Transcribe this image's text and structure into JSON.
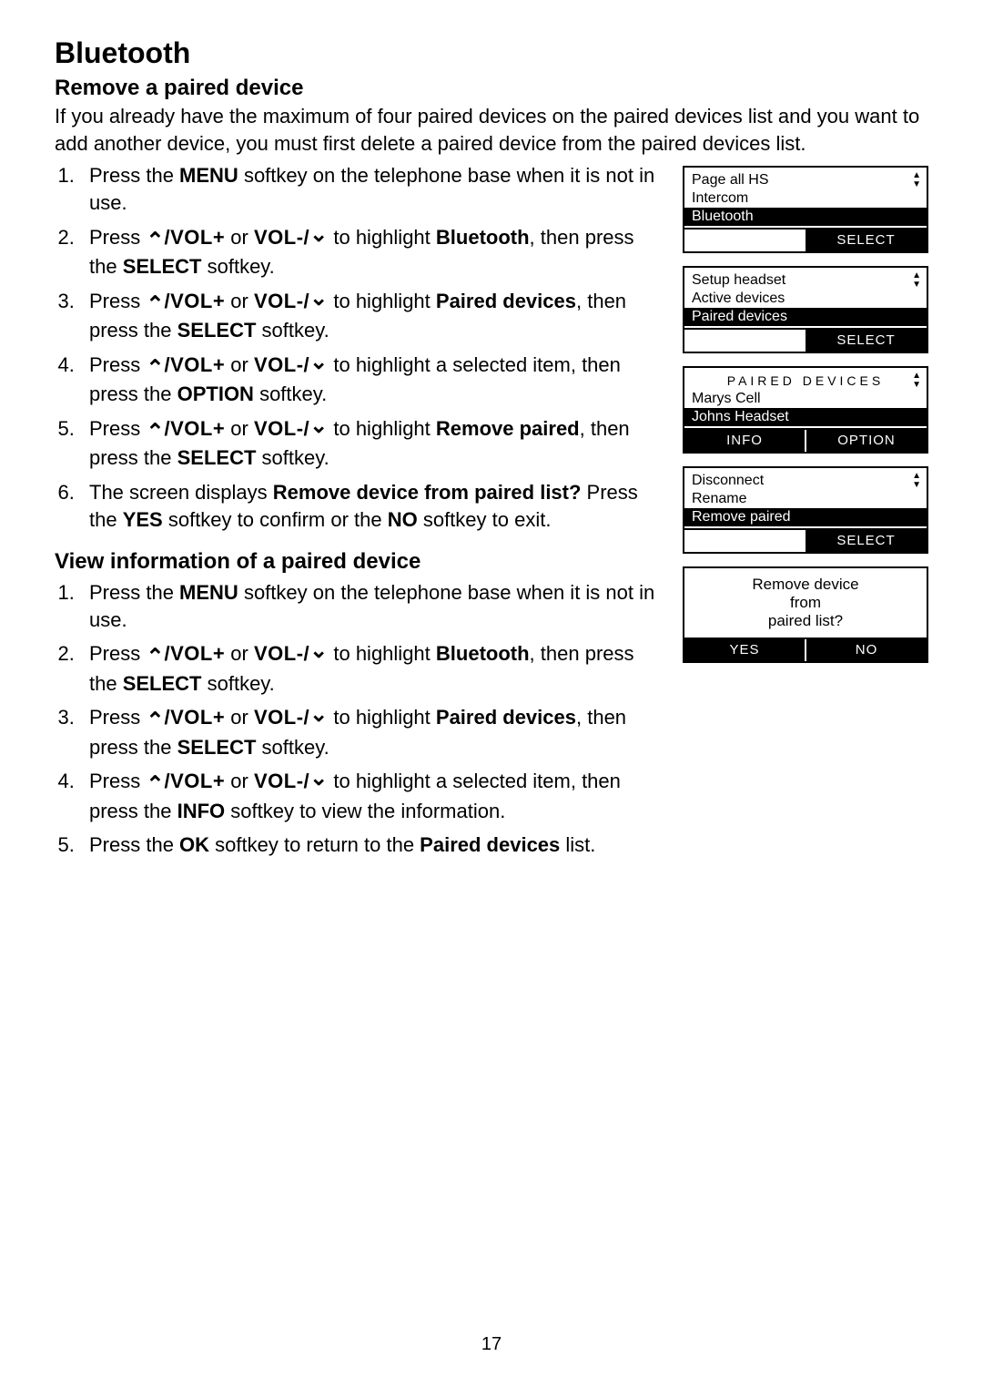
{
  "page_title": "Bluetooth",
  "page_number": "17",
  "icons": {
    "up": "⌃",
    "down": "⌄"
  },
  "vol": {
    "plus": "VOL+",
    "minus": "VOL-/"
  },
  "section_remove": {
    "heading": "Remove a paired device",
    "intro": "If you already have the maximum of four paired devices on the paired devices list and you want to add another device, you must first delete a paired device from the paired devices list.",
    "steps": {
      "s1a": "Press the ",
      "s1b": "MENU",
      "s1c": " softkey on the telephone base when it is not in use.",
      "s2a": "Press ",
      "s2b": " or ",
      "s2c": " to highlight ",
      "s2d": "Bluetooth",
      "s2e": ", then press the ",
      "s2f": "SELECT",
      "s2g": " softkey.",
      "s3a": "Press ",
      "s3b": " or ",
      "s3c": " to highlight ",
      "s3d": "Paired devices",
      "s3e": ", then press the ",
      "s3f": "SELECT",
      "s3g": " softkey.",
      "s4a": "Press ",
      "s4b": " or ",
      "s4c": " to highlight a selected item, then press the ",
      "s4d": "OPTION",
      "s4e": " softkey.",
      "s5a": "Press ",
      "s5b": " or ",
      "s5c": " to highlight ",
      "s5d": "Remove paired",
      "s5e": ", then press the ",
      "s5f": "SELECT",
      "s5g": " softkey.",
      "s6a": "The screen displays ",
      "s6b": "Remove device from paired list?",
      "s6c": " Press the ",
      "s6d": "YES",
      "s6e": " softkey to confirm or the ",
      "s6f": "NO",
      "s6g": " softkey to exit."
    }
  },
  "section_view": {
    "heading": "View information of a paired device",
    "steps": {
      "s1a": "Press the ",
      "s1b": "MENU",
      "s1c": " softkey on the telephone base when it is not in use.",
      "s2a": "Press ",
      "s2b": " or ",
      "s2c": " to highlight ",
      "s2d": "Bluetooth",
      "s2e": ", then press the ",
      "s2f": "SELECT",
      "s2g": " softkey.",
      "s3a": "Press ",
      "s3b": " or ",
      "s3c": " to highlight ",
      "s3d": "Paired devices",
      "s3e": ", then press the ",
      "s3f": "SELECT",
      "s3g": " softkey.",
      "s4a": "Press ",
      "s4b": " or ",
      "s4c": " to highlight a selected item, then press the ",
      "s4d": "INFO",
      "s4e": " softkey to view the information.",
      "s5a": "Press the ",
      "s5b": "OK",
      "s5c": " softkey to return to the ",
      "s5d": "Paired devices",
      "s5e": " list."
    }
  },
  "screens": {
    "menu1": {
      "line1": "Page all HS",
      "line2": "Intercom",
      "selected": "Bluetooth",
      "softkey_right": "SELECT"
    },
    "menu2": {
      "line1": "Setup headset",
      "line2": "Active devices",
      "selected": "Paired devices",
      "softkey_right": "SELECT"
    },
    "menu3": {
      "title": "PAIRED DEVICES",
      "line1": "Marys Cell",
      "selected": "Johns Headset",
      "softkey_left": "INFO",
      "softkey_right": "OPTION"
    },
    "menu4": {
      "line1": "Disconnect",
      "line2": "Rename",
      "selected": "Remove paired",
      "softkey_right": "SELECT"
    },
    "menu5": {
      "text": "Remove device\nfrom\npaired list?",
      "softkey_left": "YES",
      "softkey_right": "NO"
    }
  }
}
